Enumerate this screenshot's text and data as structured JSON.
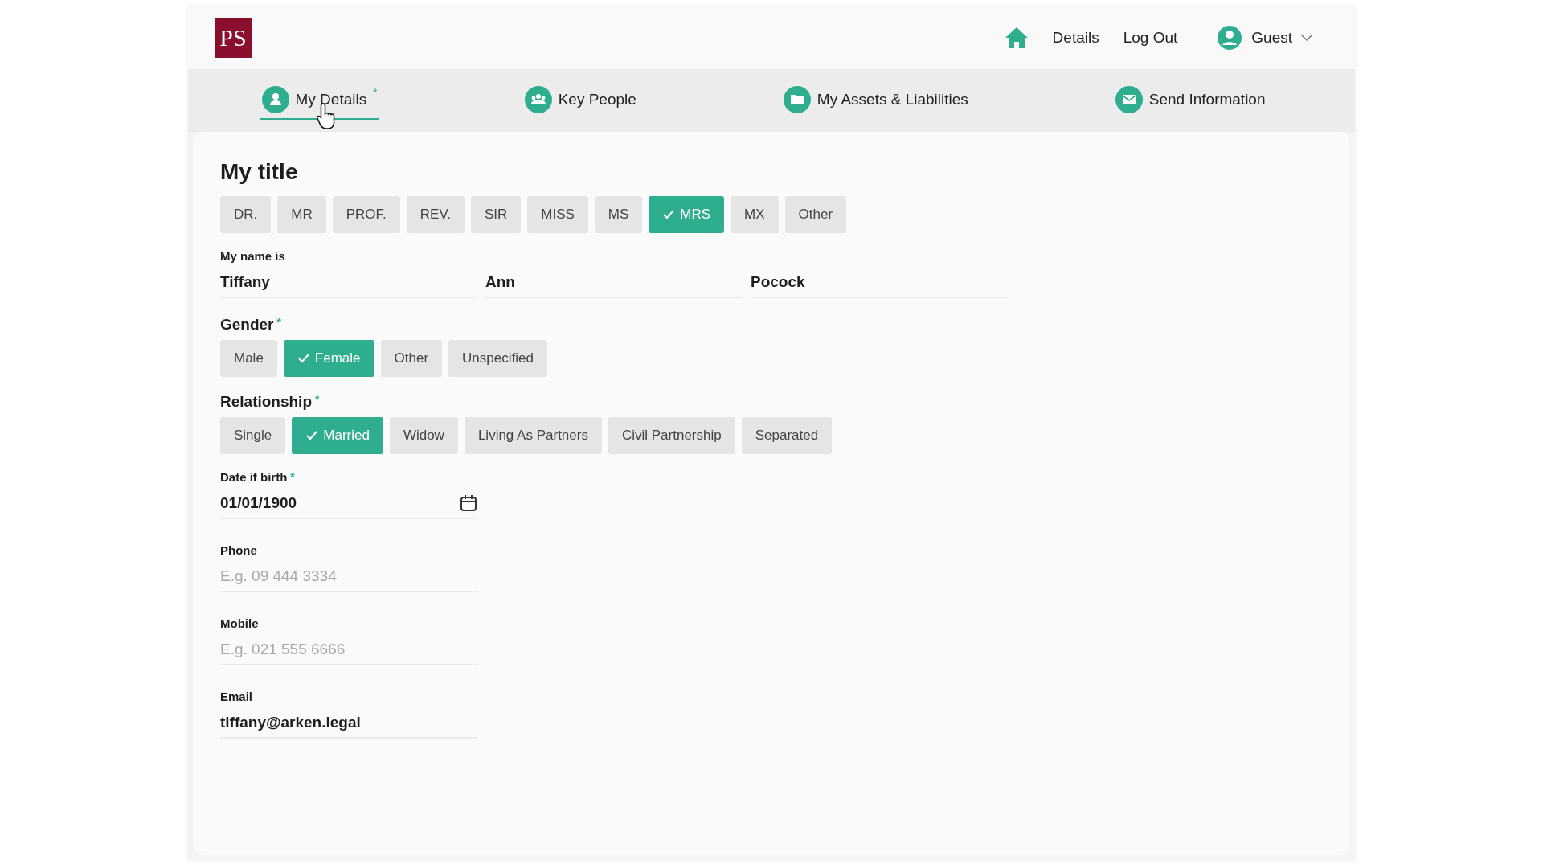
{
  "header": {
    "logo": "PS",
    "links": [
      {
        "kind": "home"
      },
      {
        "kind": "text",
        "label": "Details"
      },
      {
        "kind": "text",
        "label": "Log Out"
      },
      {
        "kind": "user",
        "label": "Guest"
      }
    ]
  },
  "tabs": [
    {
      "label": "My Details",
      "required_mark": "*",
      "selected": true
    },
    {
      "label": "Key People",
      "selected": false
    },
    {
      "label": "My Assets & Liabilities",
      "selected": false
    },
    {
      "label": "Send Information",
      "selected": false
    }
  ],
  "form": {
    "title": "My title",
    "title_options": [
      {
        "label": "DR.",
        "selected": false
      },
      {
        "label": "MR",
        "selected": false
      },
      {
        "label": "PROF.",
        "selected": false
      },
      {
        "label": "REV.",
        "selected": false
      },
      {
        "label": "SIR",
        "selected": false
      },
      {
        "label": "MISS",
        "selected": false
      },
      {
        "label": "MS",
        "selected": false
      },
      {
        "label": "MRS",
        "selected": true
      },
      {
        "label": "MX",
        "selected": false
      },
      {
        "label": "Other",
        "selected": false
      }
    ],
    "name": {
      "label": "My name is",
      "values": [
        "Tiffany",
        "Ann",
        "Pocock"
      ]
    },
    "groups": [
      {
        "label": "Gender",
        "required_mark": "*",
        "options": [
          {
            "label": "Male",
            "selected": false
          },
          {
            "label": "Female",
            "selected": true
          },
          {
            "label": "Other",
            "selected": false
          },
          {
            "label": "Unspecified",
            "selected": false
          }
        ]
      },
      {
        "label": "Relationship",
        "required_mark": "*",
        "options": [
          {
            "label": "Single",
            "selected": false
          },
          {
            "label": "Married",
            "selected": true
          },
          {
            "label": "Widow",
            "selected": false
          },
          {
            "label": "Living As Partners",
            "selected": false
          },
          {
            "label": "Civil Partnership",
            "selected": false
          },
          {
            "label": "Separated",
            "selected": false
          }
        ]
      }
    ],
    "fields": [
      {
        "kind": "date",
        "label": "Date if birth",
        "required_mark": "*",
        "value": "01/01/1900"
      },
      {
        "kind": "text",
        "label": "Phone",
        "placeholder": "E.g. 09 444 3334"
      },
      {
        "kind": "text",
        "label": "Mobile",
        "placeholder": "E.g. 021 555 6666"
      },
      {
        "kind": "text",
        "label": "Email",
        "value": "tiffany@arken.legal"
      }
    ]
  }
}
